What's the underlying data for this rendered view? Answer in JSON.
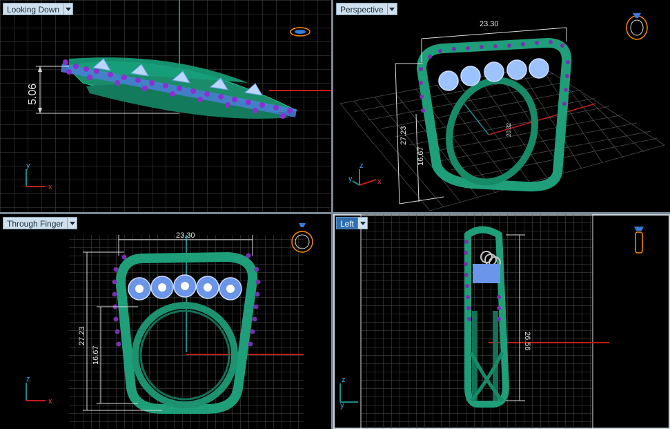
{
  "viewports": {
    "top_left": {
      "label": "Looking Down",
      "dimension": "5.06",
      "axis_v": "y",
      "axis_h": "x"
    },
    "top_right": {
      "label": "Perspective",
      "dim_width": "23.30",
      "dim_height": "27.23",
      "dim_inner": "16.67",
      "dim_center": "20.32",
      "axis_v": "z",
      "axis_h": "x",
      "axis_side": "y"
    },
    "bottom_left": {
      "label": "Through Finger",
      "dim_width": "23.30",
      "dim_height": "27.23",
      "dim_inner": "16.67",
      "axis_v": "z",
      "axis_h": "x"
    },
    "bottom_right": {
      "label": "Left",
      "dim_height": "26.56",
      "axis_v": "z",
      "axis_h": "y"
    }
  },
  "colors": {
    "band": "#1f9e7a",
    "stone": "#7fb2ff",
    "bead": "#7a2fb0",
    "grid": "#5a5a5a",
    "red_axis": "#c41b1b",
    "green_axis": "#1b8b8b"
  }
}
